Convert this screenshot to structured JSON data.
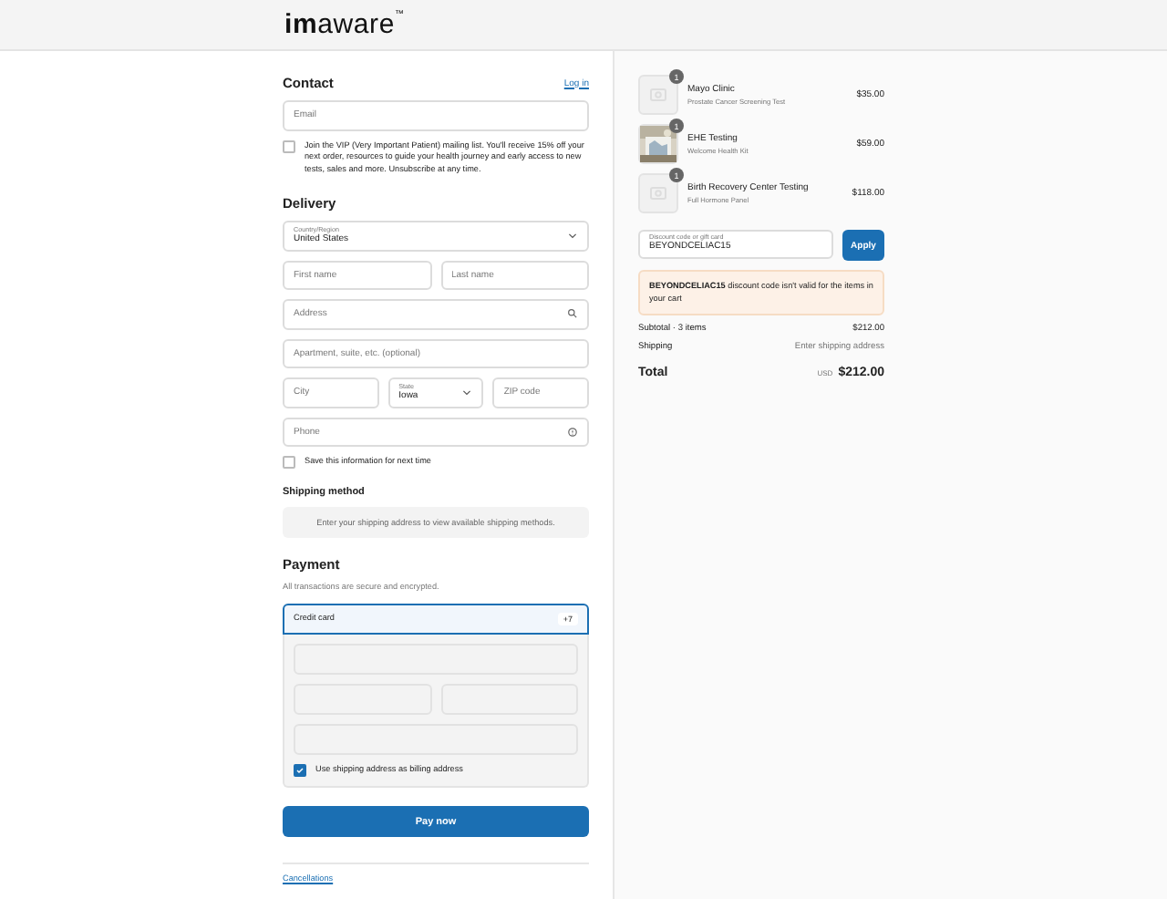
{
  "header": {
    "logo_bold": "im",
    "logo_light": "aware",
    "trademark": "™"
  },
  "contact": {
    "title": "Contact",
    "login": "Log in",
    "email": {
      "placeholder": "Email"
    },
    "vip": {
      "checked": false,
      "text": "Join the VIP (Very Important Patient) mailing list. You'll receive 15% off your next order, resources to guide your health journey and early access to new tests, sales and more. Unsubscribe at any time."
    }
  },
  "delivery": {
    "title": "Delivery",
    "country": {
      "label": "Country/Region",
      "value": "United States"
    },
    "first_name": {
      "placeholder": "First name"
    },
    "last_name": {
      "placeholder": "Last name"
    },
    "address": {
      "placeholder": "Address"
    },
    "apartment": {
      "placeholder": "Apartment, suite, etc. (optional)"
    },
    "city": {
      "placeholder": "City"
    },
    "state": {
      "label": "State",
      "value": "Iowa"
    },
    "zip": {
      "placeholder": "ZIP code"
    },
    "phone": {
      "placeholder": "Phone"
    },
    "save": {
      "checked": false,
      "text": "Save this information for next time"
    }
  },
  "shipping": {
    "title": "Shipping method",
    "notice": "Enter your shipping address to view available shipping methods."
  },
  "payment": {
    "title": "Payment",
    "subtitle": "All transactions are secure and encrypted.",
    "method": {
      "label": "Credit card",
      "selected": true,
      "more": "+7"
    },
    "billing": {
      "checked": true,
      "text": "Use shipping address as billing address"
    }
  },
  "pay_button": "Pay now",
  "footer_link": "Cancellations",
  "cart": {
    "items": [
      {
        "name": "Mayo Clinic",
        "subtitle": "Prostate Cancer Screening Test",
        "price": "$35.00",
        "quantity": "1",
        "kind": "placeholder"
      },
      {
        "name": "EHE Testing",
        "subtitle": "Welcome Health Kit",
        "price": "$59.00",
        "quantity": "1",
        "kind": "picture"
      },
      {
        "name": "Birth Recovery Center Testing",
        "subtitle": "Full Hormone Panel",
        "price": "$118.00",
        "quantity": "1",
        "kind": "placeholder"
      }
    ],
    "discount": {
      "label": "Discount code or gift card",
      "value": "BEYONDCELIAC15",
      "button": "Apply"
    },
    "error": {
      "code": "BEYONDCELIAC15",
      "text": " discount code isn't valid for the items in your cart"
    },
    "subtotal": {
      "label": "Subtotal · 3 items",
      "value": "$212.00"
    },
    "shipping": {
      "label": "Shipping",
      "value": "Enter shipping address"
    },
    "total": {
      "label": "Total",
      "currency": "USD",
      "value": "$212.00"
    }
  }
}
